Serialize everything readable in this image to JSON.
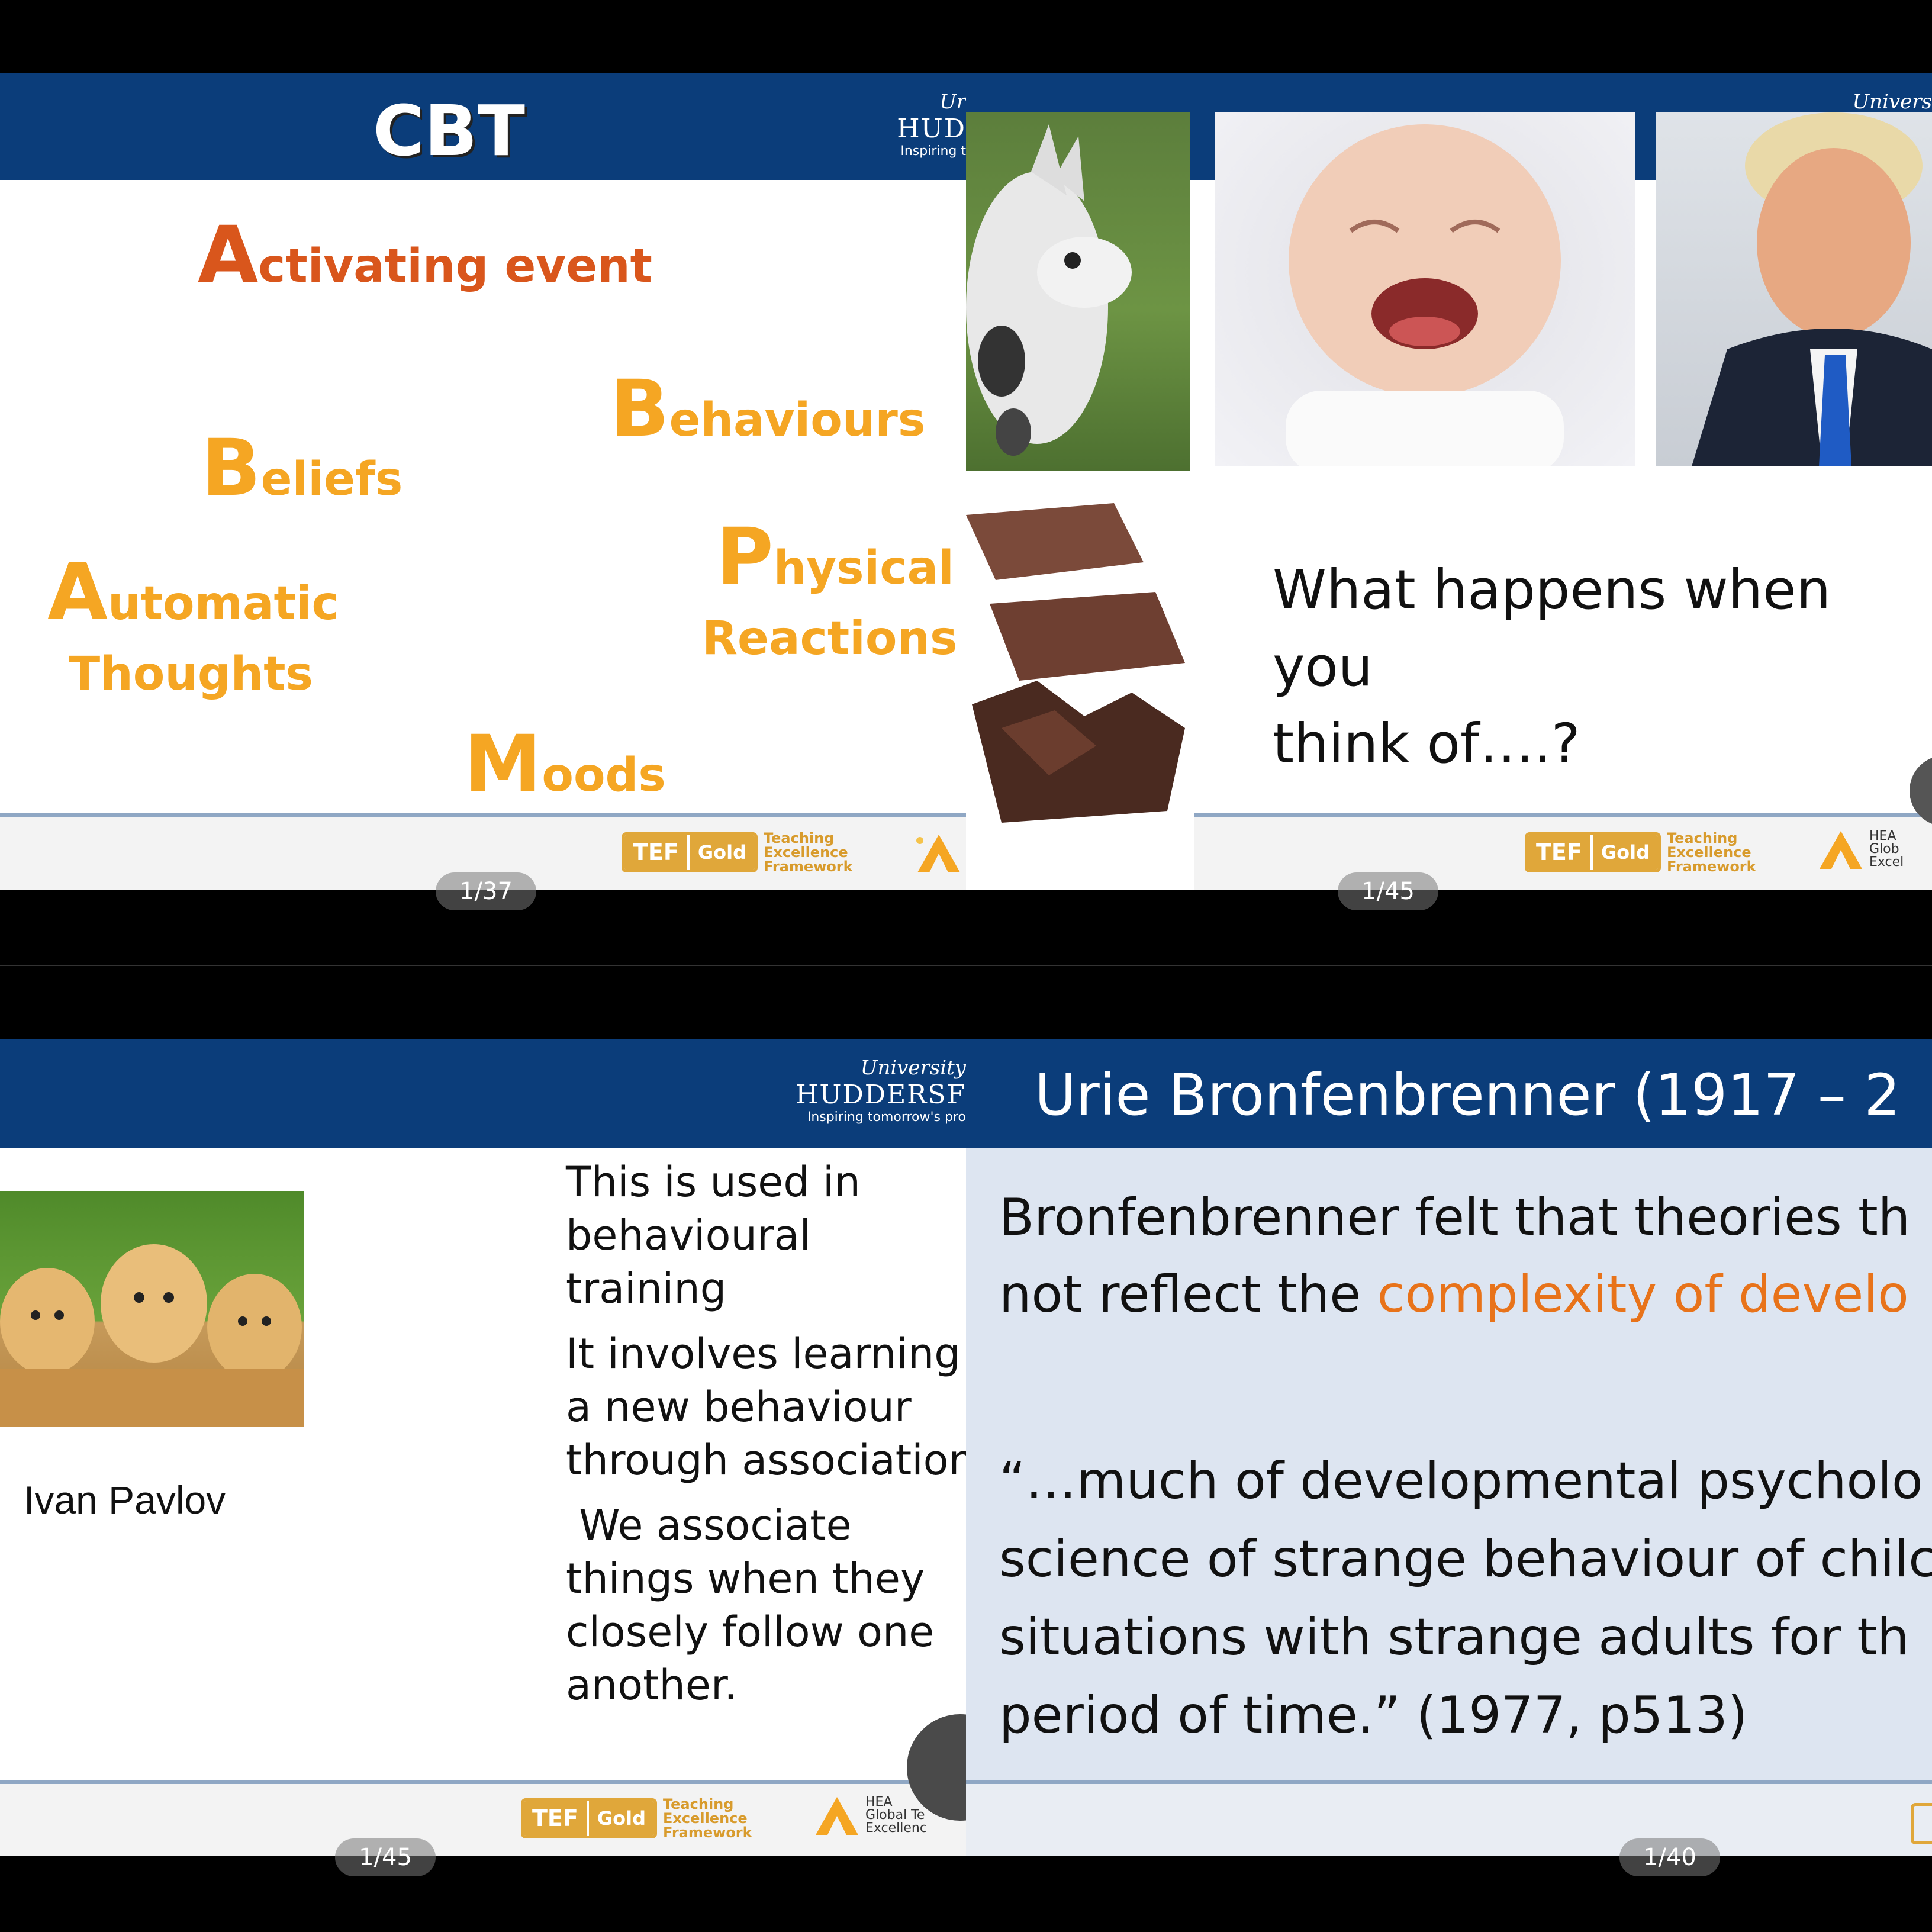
{
  "slide1": {
    "title": "CBT",
    "words": {
      "activating_cap": "A",
      "activating_rest": "ctivating event",
      "behaviours_cap": "B",
      "behaviours_rest": "ehaviours",
      "beliefs_cap": "B",
      "beliefs_rest": "eliefs",
      "physical_cap": "P",
      "physical_rest": "hysical",
      "reactions": "Reactions",
      "automatic_cap": "A",
      "automatic_rest": "utomatic",
      "thoughts": "Thoughts",
      "moods_cap": "M",
      "moods_rest": "oods"
    },
    "logo": {
      "line1": "Ur",
      "line2": "HUD",
      "line3": "Inspiring t"
    },
    "page_indicator": "1/37"
  },
  "slide2": {
    "logo_line1": "Univers",
    "question_line1": "What happens when you",
    "question_line2": "think of….?",
    "page_indicator": "1/45"
  },
  "slide3": {
    "logo": {
      "line1": "University",
      "line2": "HUDDERSF",
      "line3": "Inspiring tomorrow's pro"
    },
    "caption": "Ivan Pavlov",
    "paragraphs": [
      "This is used in behavioural training",
      "It involves learning a new behaviour through association",
      " We associate things when they closely follow one another."
    ],
    "page_indicator": "1/45"
  },
  "slide4": {
    "title": "Urie Bronfenbrenner (1917 – 2",
    "text_line1": "Bronfenbrenner felt that theories th",
    "text_line2_pre": "not reflect the ",
    "text_line2_highlight": "complexity of develo",
    "quote_lines": [
      "“…much of developmental psycholo",
      "science of strange behaviour of chilc",
      "situations with strange adults for th",
      "period of time.”  (1977, p513)"
    ],
    "page_indicator": "1/40"
  },
  "tef": {
    "tef": "TEF",
    "gold": "Gold",
    "l1": "Teaching",
    "l2": "Excellence",
    "l3": "Framework"
  },
  "hea": {
    "l1": "HEA",
    "l2": "Global Te",
    "l3": "Excellenc"
  },
  "hea_short": {
    "l1": "HEA",
    "l2": "Glob",
    "l3": "Excel"
  },
  "colors": {
    "band": "#0b3d7a",
    "orange": "#f5a623",
    "accent_orange": "#e8731a"
  }
}
